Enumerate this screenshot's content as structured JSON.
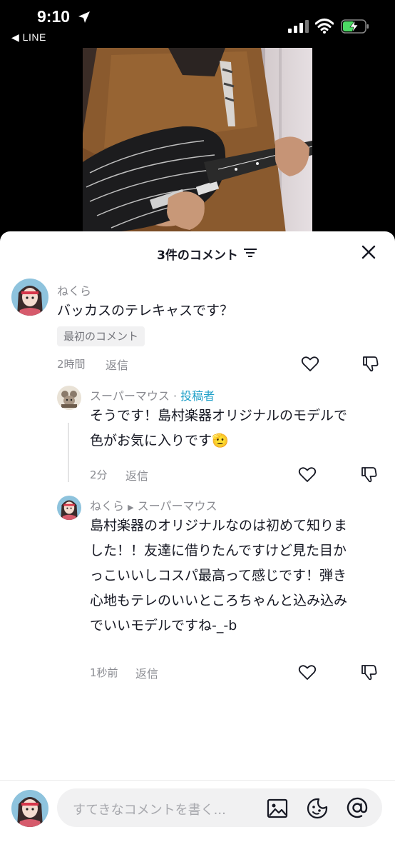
{
  "status_bar": {
    "time": "9:10",
    "back_label": "◀ LINE"
  },
  "sheet": {
    "title": "3件のコメント",
    "close_label": "close"
  },
  "comments": [
    {
      "user": "ねくら",
      "text": "バッカスのテレキャスです？",
      "badge": "最初のコメント",
      "time": "2時間",
      "reply": "返信"
    },
    {
      "user": "スーパーマウス",
      "separator": "·",
      "author_tag": "投稿者",
      "text_lines": [
        "そうです！島村楽器オリジナルのモデルで",
        "色がお気に入りです🫡"
      ],
      "time": "2分",
      "reply": "返信"
    },
    {
      "user": "ねくら",
      "reply_to": "スーパーマウス",
      "text_lines": [
        "島村楽器のオリジナルなのは初めて知りま",
        "した！！友達に借りたんですけど見た目か",
        "っこいいしコスパ最高って感じです！弾き",
        "心地もテレのいいところちゃんと込み込み",
        "でいいモデルですね-_-b"
      ],
      "time": "1秒前",
      "reply": "返信"
    }
  ],
  "input": {
    "placeholder": "すてきなコメントを書く..."
  },
  "icons": [
    "location-arrow-icon",
    "signal-icon",
    "wifi-icon",
    "battery-charging-icon",
    "sort-icon",
    "close-icon",
    "heart-icon",
    "dislike-icon",
    "image-icon",
    "emoji-icon",
    "mention-icon"
  ]
}
